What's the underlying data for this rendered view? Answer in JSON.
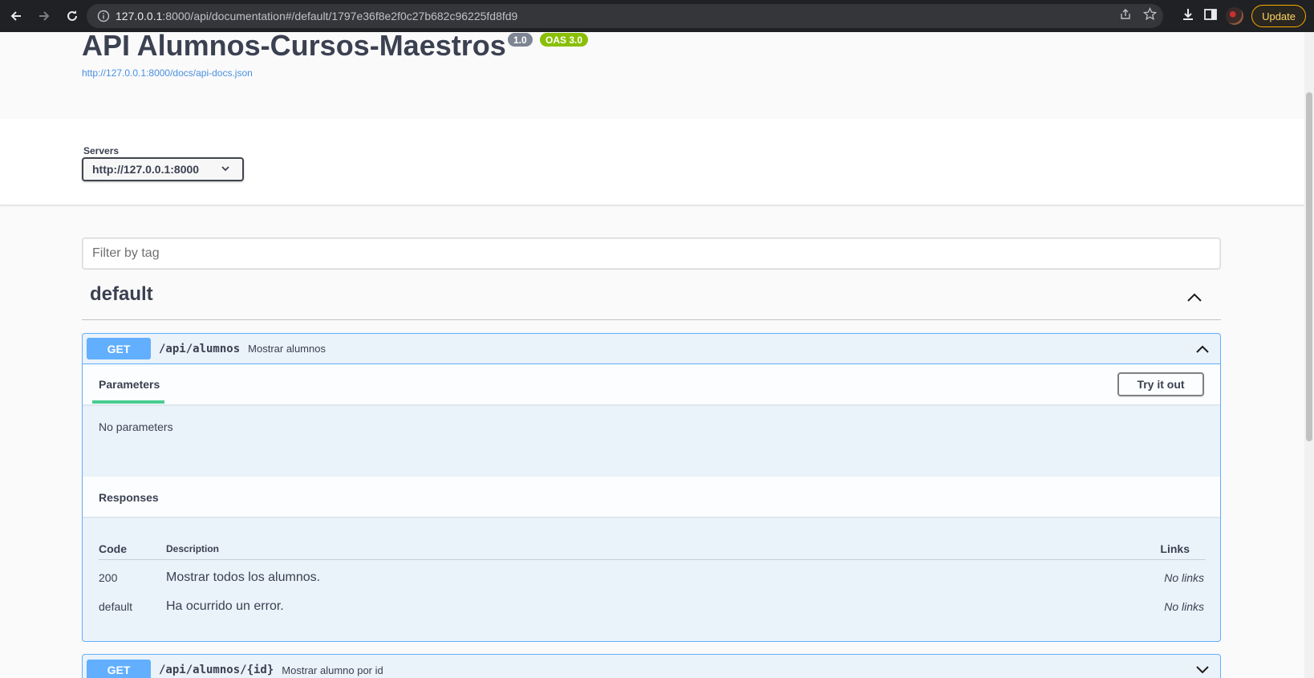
{
  "browser": {
    "url_host": "127.0.0.1",
    "url_rest": ":8000/api/documentation#/default/1797e36f8e2f0c27b682c96225fd8fd9",
    "update_label": "Update"
  },
  "info": {
    "title": "API Alumnos-Cursos-Maestros",
    "version": "1.0",
    "oas": "OAS 3.0",
    "spec_url": "http://127.0.0.1:8000/docs/api-docs.json"
  },
  "servers": {
    "label": "Servers",
    "selected": "http://127.0.0.1:8000"
  },
  "filter": {
    "placeholder": "Filter by tag"
  },
  "tag": {
    "name": "default"
  },
  "operations": [
    {
      "method": "GET",
      "path": "/api/alumnos",
      "summary": "Mostrar alumnos",
      "params_tab": "Parameters",
      "try_label": "Try it out",
      "no_params": "No parameters",
      "responses_title": "Responses",
      "columns": {
        "code": "Code",
        "description": "Description",
        "links": "Links"
      },
      "responses": [
        {
          "code": "200",
          "description": "Mostrar todos los alumnos.",
          "links": "No links"
        },
        {
          "code": "default",
          "description": "Ha ocurrido un error.",
          "links": "No links"
        }
      ]
    },
    {
      "method": "GET",
      "path": "/api/alumnos/{id}",
      "summary": "Mostrar alumno por id"
    }
  ]
}
